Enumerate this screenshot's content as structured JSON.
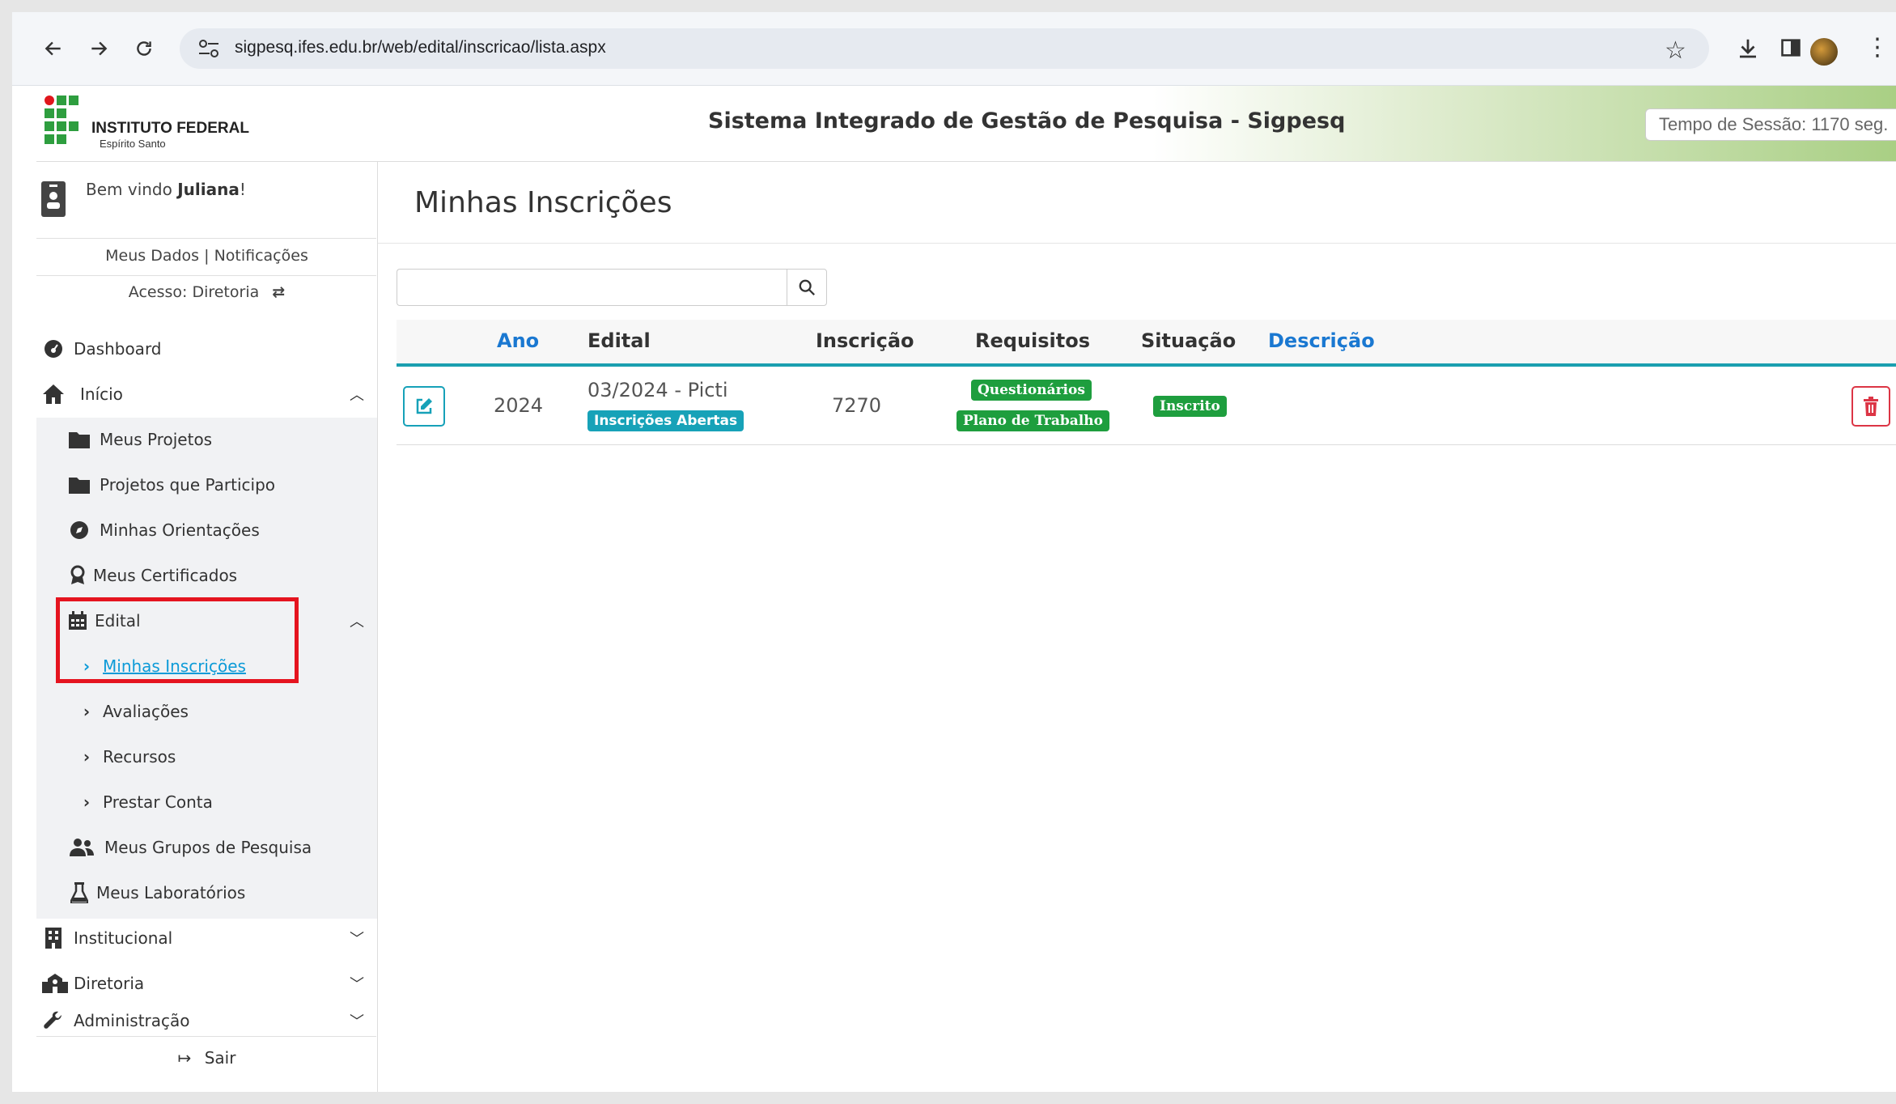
{
  "browser": {
    "url": "sigpesq.ifes.edu.br/web/edital/inscricao/lista.aspx",
    "back_icon": "back-arrow-icon",
    "forward_icon": "forward-arrow-icon",
    "reload_icon": "reload-icon"
  },
  "header": {
    "logo_name": "INSTITUTO FEDERAL",
    "logo_sub": "Espírito Santo",
    "system_title": "Sistema Integrado de Gestão de Pesquisa - Sigpesq",
    "session_timer": "Tempo de Sessão: 1170 seg."
  },
  "sidebar": {
    "welcome_prefix": "Bem vindo ",
    "user_name": "Juliana",
    "welcome_suffix": "!",
    "meus_dados": "Meus Dados",
    "divider": "|",
    "notificacoes": "Notificações",
    "access": "Acesso: Diretoria",
    "items": [
      {
        "label": "Dashboard",
        "icon": "dashboard-icon"
      },
      {
        "label": "Início",
        "icon": "home-icon"
      },
      {
        "label": "Meus Projetos",
        "icon": "folder-icon"
      },
      {
        "label": "Projetos que Participo",
        "icon": "folder-icon"
      },
      {
        "label": "Minhas Orientações",
        "icon": "compass-icon"
      },
      {
        "label": "Meus Certificados",
        "icon": "certificate-icon"
      },
      {
        "label": "Edital",
        "icon": "calendar-icon"
      },
      {
        "label": "Minhas Inscrições",
        "icon": "chevron-right-icon"
      },
      {
        "label": "Avaliações",
        "icon": "chevron-right-icon"
      },
      {
        "label": "Recursos",
        "icon": "chevron-right-icon"
      },
      {
        "label": "Prestar Conta",
        "icon": "chevron-right-icon"
      },
      {
        "label": "Meus Grupos de Pesquisa",
        "icon": "users-icon"
      },
      {
        "label": "Meus Laboratórios",
        "icon": "flask-icon"
      },
      {
        "label": "Institucional",
        "icon": "building-icon"
      },
      {
        "label": "Diretoria",
        "icon": "school-icon"
      },
      {
        "label": "Administração",
        "icon": "wrench-icon"
      }
    ],
    "logout": "Sair"
  },
  "main": {
    "page_title": "Minhas Inscrições",
    "search_placeholder": "",
    "columns": [
      "Ano",
      "Edital",
      "Inscrição",
      "Requisitos",
      "Situação",
      "Descrição"
    ],
    "rows": [
      {
        "ano": "2024",
        "edital": "03/2024 - Picti",
        "edital_badge": "Inscrições Abertas",
        "inscricao": "7270",
        "requisitos": [
          "Questionários",
          "Plano de Trabalho"
        ],
        "situacao": "Inscrito",
        "descricao": ""
      }
    ]
  },
  "colors": {
    "accent_teal": "#17a2b8",
    "success_green": "#1e9e3e",
    "danger_red": "#dc3545",
    "link_blue": "#0d9bd8",
    "highlight_red": "#e5141f"
  }
}
